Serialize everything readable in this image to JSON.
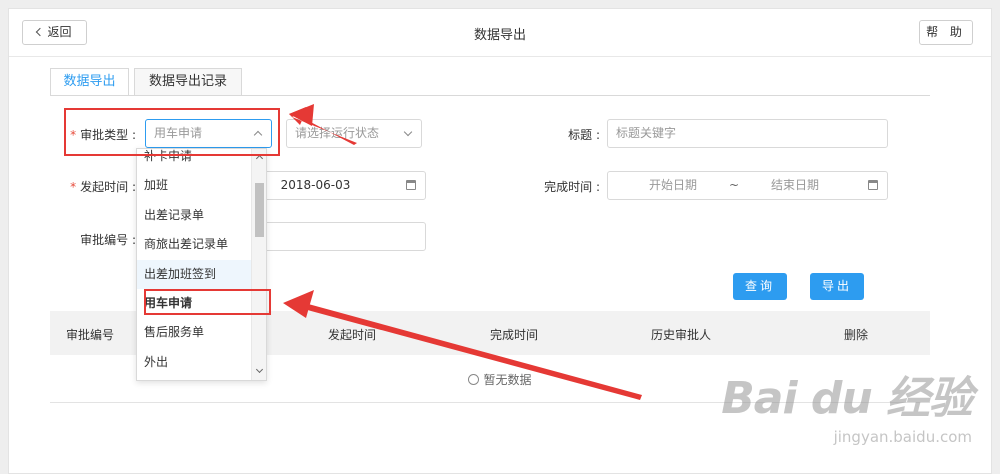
{
  "header": {
    "back_label": "返回",
    "title": "数据导出",
    "help_label": "帮 助"
  },
  "tabs": [
    {
      "label": "数据导出",
      "active": true
    },
    {
      "label": "数据导出记录",
      "active": false
    }
  ],
  "form": {
    "approval_type": {
      "label": "审批类型 :",
      "required": true,
      "placeholder": "用车申请"
    },
    "status": {
      "placeholder": "请选择运行状态"
    },
    "title": {
      "label": "标题 :",
      "placeholder": "标题关键字"
    },
    "start_time": {
      "label": "发起时间 :",
      "required": true,
      "value": "2018-06-03"
    },
    "finish_time": {
      "label": "完成时间 :",
      "start_placeholder": "开始日期",
      "separator": "~",
      "end_placeholder": "结束日期"
    },
    "approval_no": {
      "label": "审批编号 :"
    }
  },
  "buttons": {
    "query": "查询",
    "export": "导出"
  },
  "table": {
    "columns": [
      "审批编号",
      "发起时间",
      "完成时间",
      "历史审批人",
      "删除"
    ],
    "empty_text": "暂无数据"
  },
  "dropdown": {
    "items": [
      {
        "label": "补卡申请"
      },
      {
        "label": "加班"
      },
      {
        "label": "出差记录单"
      },
      {
        "label": "商旅出差记录单"
      },
      {
        "label": "出差加班签到"
      },
      {
        "label": "用车申请"
      },
      {
        "label": "售后服务单"
      },
      {
        "label": "外出"
      }
    ],
    "hovered_index": 4,
    "selected_index": 5
  },
  "annotation_color": "#e53935",
  "accent_color": "#2d9cf0",
  "watermark": {
    "text": "Bai du 经验",
    "sub": "jingyan.baidu.com"
  }
}
